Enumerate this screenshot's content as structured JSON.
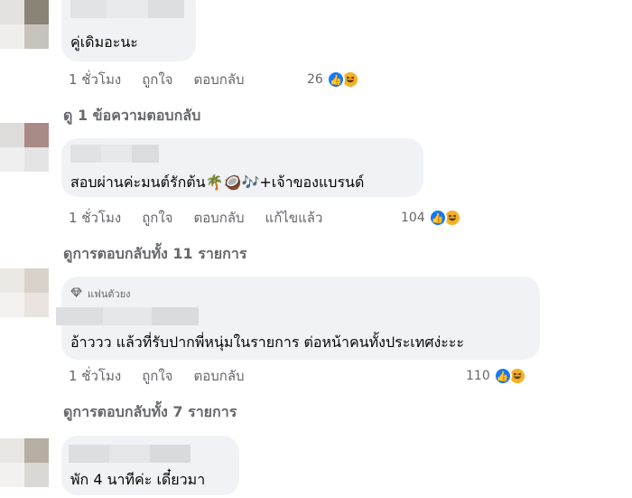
{
  "comments": [
    {
      "text": "คู่เดิมอะนะ",
      "time": "1 ชั่วโมง",
      "like": "ถูกใจ",
      "reply": "ตอบกลับ",
      "edited": "",
      "reaction_count": "26",
      "replies_link": "ดู 1 ข้อความตอบกลับ",
      "badge": ""
    },
    {
      "text": "สอบผ่านค่ะมนต์รักต้น🌴🥥🎶+เจ้าของแบรนด์",
      "time": "1 ชั่วโมง",
      "like": "ถูกใจ",
      "reply": "ตอบกลับ",
      "edited": "แก้ไขแล้ว",
      "reaction_count": "104",
      "replies_link": "ดูการตอบกลับทั้ง 11 รายการ",
      "badge": ""
    },
    {
      "text": "อ้าววว แล้วที่รับปากพี่หนุ่มในรายการ ต่อหน้าคนทั้งประเทศง่ะะะ",
      "time": "1 ชั่วโมง",
      "like": "ถูกใจ",
      "reply": "ตอบกลับ",
      "edited": "",
      "reaction_count": "110",
      "replies_link": "ดูการตอบกลับทั้ง 7 รายการ",
      "badge": "แฟนตัวยง"
    },
    {
      "text": "พัก 4 นาทีค่ะ เดี๋ยวมา",
      "badge": ""
    }
  ],
  "colors": {
    "bubble": "#f0f2f5",
    "meta_text": "#65676b",
    "like_blue": "#1877f2",
    "haha_yellow": "#f7b125"
  },
  "icons": [
    "like-reaction-icon",
    "haha-reaction-icon",
    "diamond-badge-icon"
  ]
}
